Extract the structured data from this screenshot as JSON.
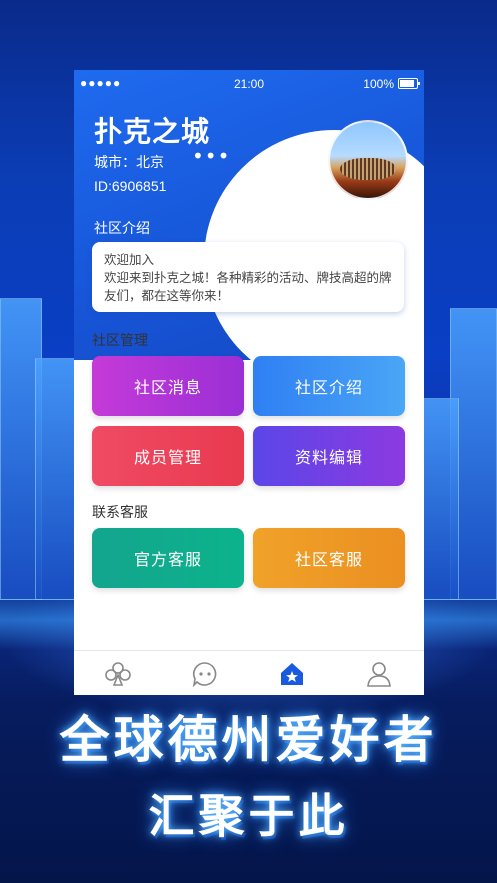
{
  "status_bar": {
    "signal": "●●●●●",
    "time": "21:00",
    "battery": "100%"
  },
  "community": {
    "name": "扑克之城",
    "city": "城市：北京",
    "more": "•••",
    "id": "ID:6906851"
  },
  "intro": {
    "label": "社区介绍",
    "title": "欢迎加入",
    "body": "欢迎来到扑克之城！各种精彩的活动、牌技高超的牌友们，都在这等你来！"
  },
  "manage": {
    "label": "社区管理",
    "buttons": [
      "社区消息",
      "社区介绍",
      "成员管理",
      "资料编辑"
    ]
  },
  "service": {
    "label": "联系客服",
    "buttons": [
      "官方客服",
      "社区客服"
    ]
  },
  "tabbar": {
    "icons": [
      "club-icon",
      "chat-icon",
      "home-star-icon",
      "user-icon"
    ],
    "active_color": "#1a5ae0"
  },
  "slogan": {
    "line1": "全球德州爱好者",
    "line2": "汇聚于此"
  }
}
